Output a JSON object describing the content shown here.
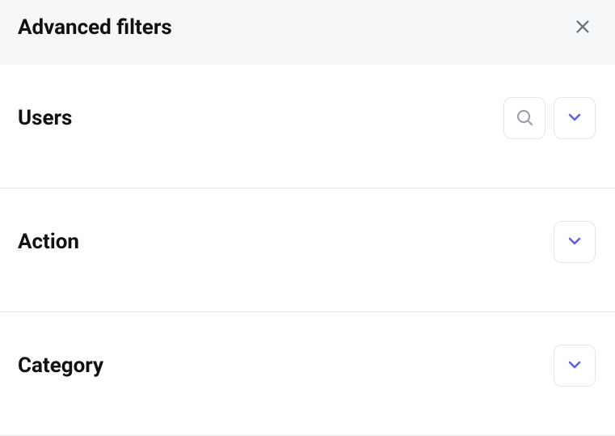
{
  "header": {
    "title": "Advanced filters"
  },
  "sections": {
    "users": {
      "title": "Users"
    },
    "action": {
      "title": "Action"
    },
    "category": {
      "title": "Category"
    }
  }
}
